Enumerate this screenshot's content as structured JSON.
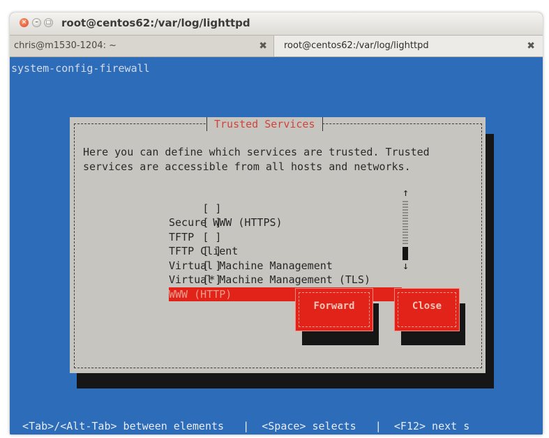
{
  "window": {
    "title": "root@centos62:/var/log/lighttpd",
    "controls": {
      "close_glyph": "×",
      "minimize_glyph": "–",
      "maximize_glyph": "□"
    }
  },
  "tabs": [
    {
      "label": "chris@m1530-1204: ~",
      "close_glyph": "✖",
      "active": false
    },
    {
      "label": "root@centos62:/var/log/lighttpd",
      "close_glyph": "✖",
      "active": true
    }
  ],
  "terminal": {
    "command": "system-config-firewall",
    "background": "#2c6cb8"
  },
  "dialog": {
    "title": "Trusted Services",
    "description": "Here you can define which services are trusted. Trusted\nservices are accessible from all hosts and networks.",
    "services": [
      {
        "checkbox": "[ ]",
        "name": "Secure WWW (HTTPS)"
      },
      {
        "checkbox": "[ ]",
        "name": "TFTP"
      },
      {
        "checkbox": "[ ]",
        "name": "TFTP Client"
      },
      {
        "checkbox": "[ ]",
        "name": "Virtual Machine Management"
      },
      {
        "checkbox": "[ ]",
        "name": "Virtual Machine Management (TLS)"
      },
      {
        "checkbox": "[*]",
        "name": "WWW (HTTP)"
      }
    ],
    "scrollbar": {
      "up_glyph": "↑",
      "down_glyph": "↓"
    },
    "buttons": {
      "forward": "Forward",
      "close": "Close"
    },
    "accent_color": "#e2231a"
  },
  "statusbar": {
    "text": "  <Tab>/<Alt-Tab> between elements   |  <Space> selects   |  <F12> next s"
  }
}
